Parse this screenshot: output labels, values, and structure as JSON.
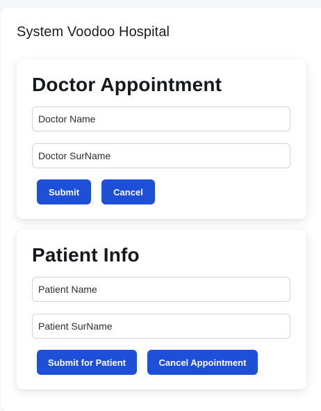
{
  "app": {
    "title": "System Voodoo Hospital"
  },
  "doctor_form": {
    "title": "Doctor Appointment",
    "name_placeholder": "Doctor Name",
    "surname_placeholder": "Doctor SurName",
    "submit_label": "Submit",
    "cancel_label": "Cancel"
  },
  "patient_form": {
    "title": "Patient Info",
    "name_placeholder": "Patient Name",
    "surname_placeholder": "Patient SurName",
    "submit_label": "Submit for Patient",
    "cancel_label": "Cancel Appointment"
  },
  "colors": {
    "primary_button": "#1d4fd8",
    "background": "#f4f6fa",
    "card": "#ffffff"
  }
}
